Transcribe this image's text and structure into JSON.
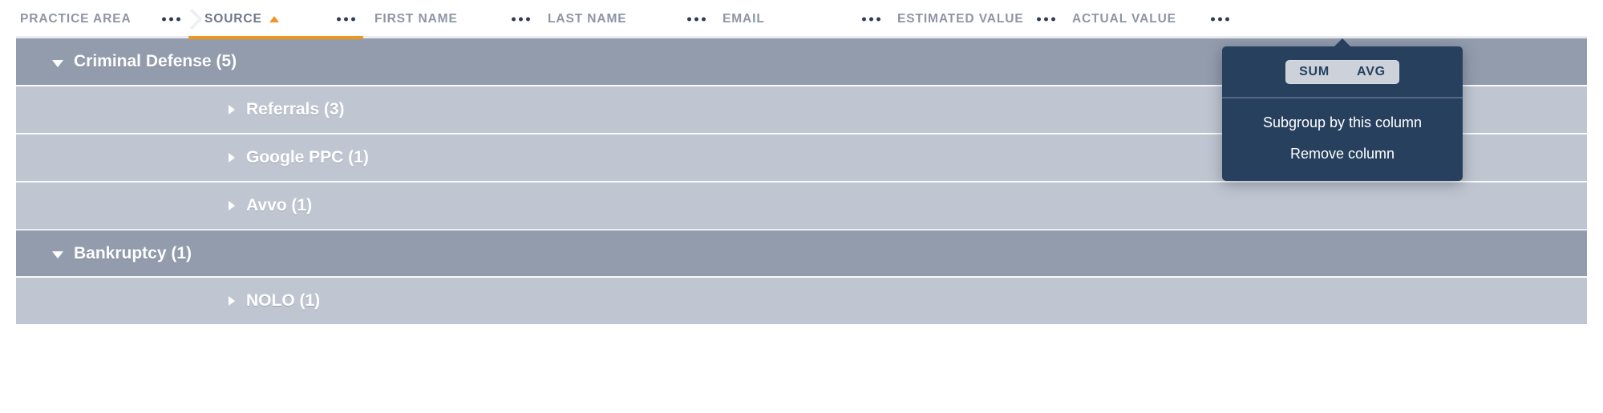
{
  "table": {
    "columns": [
      {
        "id": "practice-area",
        "label": "PRACTICE AREA",
        "sorted": false,
        "menu_icon": "ellipsis-icon"
      },
      {
        "id": "source",
        "label": "SOURCE",
        "sorted": true,
        "sort_direction": "asc",
        "sort_icon": "sort-ascending-caret-icon",
        "menu_icon": "ellipsis-icon"
      },
      {
        "id": "first-name",
        "label": "FIRST NAME",
        "sorted": false,
        "menu_icon": "ellipsis-icon"
      },
      {
        "id": "last-name",
        "label": "LAST NAME",
        "sorted": false,
        "menu_icon": "ellipsis-icon"
      },
      {
        "id": "email",
        "label": "EMAIL",
        "sorted": false,
        "menu_icon": "ellipsis-icon"
      },
      {
        "id": "estimated-value",
        "label": "ESTIMATED VALUE",
        "sorted": false,
        "menu_icon": "ellipsis-icon"
      },
      {
        "id": "actual-value",
        "label": "ACTUAL VALUE",
        "sorted": false,
        "menu_icon": "ellipsis-icon"
      }
    ],
    "rows": [
      {
        "level": "group",
        "label": "Criminal Defense (5)",
        "expanded": true,
        "toggle_icon": "caret-down-icon"
      },
      {
        "level": "sub",
        "label": "Referrals (3)",
        "expanded": false,
        "toggle_icon": "caret-right-icon"
      },
      {
        "level": "sub",
        "label": "Google PPC (1)",
        "expanded": false,
        "toggle_icon": "caret-right-icon"
      },
      {
        "level": "sub",
        "label": "Avvo (1)",
        "expanded": false,
        "toggle_icon": "caret-right-icon"
      },
      {
        "level": "group",
        "label": "Bankruptcy (1)",
        "expanded": true,
        "toggle_icon": "caret-down-icon"
      },
      {
        "level": "sub",
        "label": "NOLO (1)",
        "expanded": false,
        "toggle_icon": "caret-right-icon"
      }
    ]
  },
  "column_menu": {
    "owner_column": "ACTUAL VALUE",
    "aggregate_toggle": {
      "options": [
        {
          "id": "sum",
          "label": "SUM",
          "selected": false
        },
        {
          "id": "avg",
          "label": "AVG",
          "selected": false
        }
      ]
    },
    "items": [
      {
        "id": "subgroup-by-this-column",
        "label": "Subgroup by this column"
      },
      {
        "id": "remove-column",
        "label": "Remove column"
      }
    ]
  },
  "colors": {
    "accent_orange": "#ee9720",
    "group_row": "#939cad",
    "sub_row": "#c0c6d1",
    "menu_background": "#26405e",
    "header_text": "#8d95a6"
  }
}
